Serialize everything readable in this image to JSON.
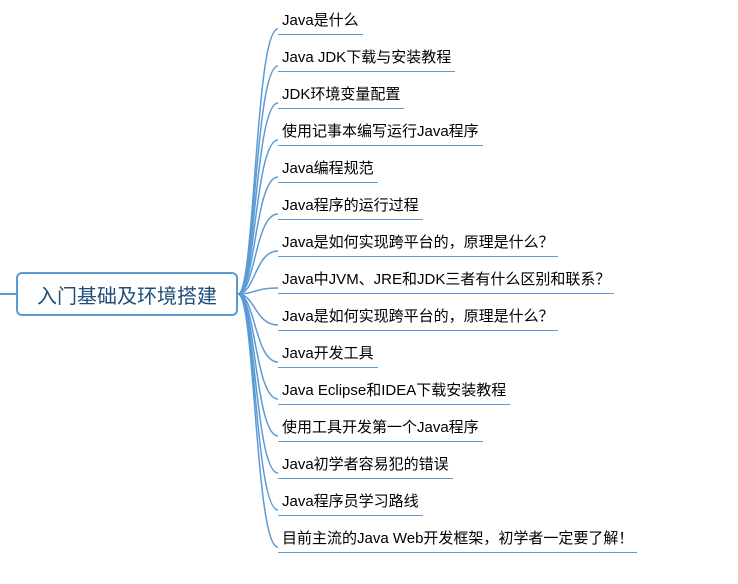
{
  "mindmap": {
    "root": {
      "label": "入门基础及环境搭建"
    },
    "children": [
      {
        "label": "Java是什么"
      },
      {
        "label": "Java JDK下载与安装教程"
      },
      {
        "label": "JDK环境变量配置"
      },
      {
        "label": "使用记事本编写运行Java程序"
      },
      {
        "label": "Java编程规范"
      },
      {
        "label": "Java程序的运行过程"
      },
      {
        "label": "Java是如何实现跨平台的，原理是什么？"
      },
      {
        "label": "Java中JVM、JRE和JDK三者有什么区别和联系？"
      },
      {
        "label": "Java是如何实现跨平台的，原理是什么？"
      },
      {
        "label": "Java开发工具"
      },
      {
        "label": "Java Eclipse和IDEA下载安装教程"
      },
      {
        "label": "使用工具开发第一个Java程序"
      },
      {
        "label": "Java初学者容易犯的错误"
      },
      {
        "label": "Java程序员学习路线"
      },
      {
        "label": "目前主流的Java Web开发框架，初学者一定要了解！"
      }
    ]
  },
  "colors": {
    "nodeBorder": "#5b9bd5",
    "rootText": "#1f4e79"
  }
}
